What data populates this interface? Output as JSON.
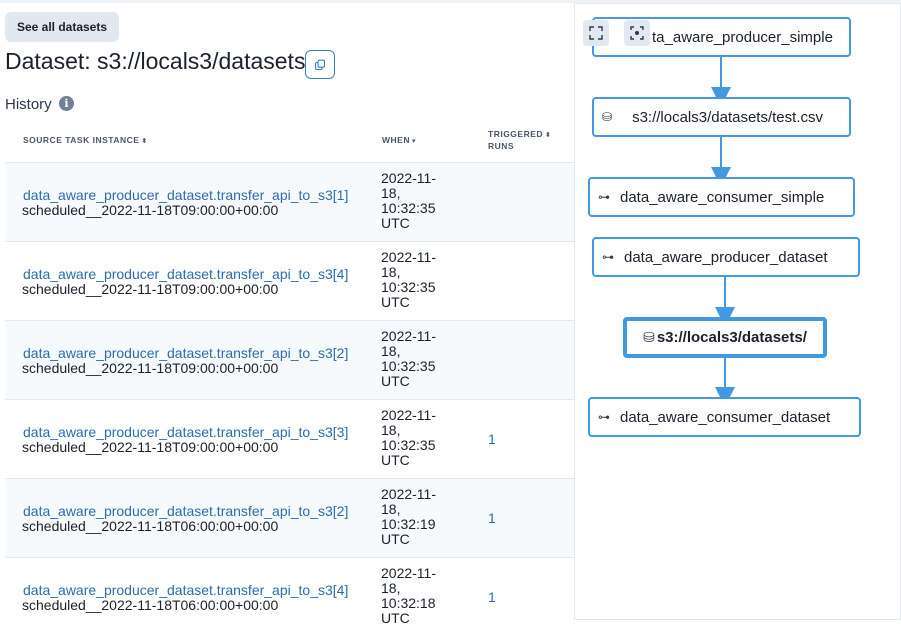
{
  "nav": {
    "see_all_label": "See all datasets"
  },
  "page": {
    "title": "Dataset: s3://locals3/datasets/"
  },
  "history": {
    "label": "History",
    "info_icon_glyph": "i",
    "columns": {
      "source": "SOURCE TASK INSTANCE",
      "when": "WHEN",
      "triggered_line1": "TRIGGERED",
      "triggered_line2": "RUNS"
    },
    "sort_glyphs": {
      "both": "⬍",
      "down": "▾"
    },
    "rows": [
      {
        "task": "data_aware_producer_dataset.transfer_api_to_s3[1]",
        "run_id": "scheduled__2022-11-18T09:00:00+00:00",
        "when": [
          "2022-11-",
          "18,",
          "10:32:35",
          "UTC"
        ],
        "runs": ""
      },
      {
        "task": "data_aware_producer_dataset.transfer_api_to_s3[4]",
        "run_id": "scheduled__2022-11-18T09:00:00+00:00",
        "when": [
          "2022-11-",
          "18,",
          "10:32:35",
          "UTC"
        ],
        "runs": ""
      },
      {
        "task": "data_aware_producer_dataset.transfer_api_to_s3[2]",
        "run_id": "scheduled__2022-11-18T09:00:00+00:00",
        "when": [
          "2022-11-",
          "18,",
          "10:32:35",
          "UTC"
        ],
        "runs": ""
      },
      {
        "task": "data_aware_producer_dataset.transfer_api_to_s3[3]",
        "run_id": "scheduled__2022-11-18T09:00:00+00:00",
        "when": [
          "2022-11-",
          "18,",
          "10:32:35",
          "UTC"
        ],
        "runs": "1"
      },
      {
        "task": "data_aware_producer_dataset.transfer_api_to_s3[2]",
        "run_id": "scheduled__2022-11-18T06:00:00+00:00",
        "when": [
          "2022-11-",
          "18,",
          "10:32:19",
          "UTC"
        ],
        "runs": "1"
      },
      {
        "task": "data_aware_producer_dataset.transfer_api_to_s3[4]",
        "run_id": "scheduled__2022-11-18T06:00:00+00:00",
        "when": [
          "2022-11-",
          "18,",
          "10:32:18",
          "UTC"
        ],
        "runs": "1"
      }
    ]
  },
  "graph": {
    "nodes": [
      {
        "label": "ta_aware_producer_simple",
        "icon": "dag",
        "glyph": ""
      },
      {
        "label": "s3://locals3/datasets/test.csv",
        "icon": "dataset",
        "glyph": "⛁"
      },
      {
        "label": "data_aware_consumer_simple",
        "icon": "dag",
        "glyph": "⊶"
      },
      {
        "label": "data_aware_producer_dataset",
        "icon": "dag",
        "glyph": "⊶"
      },
      {
        "label": "s3://locals3/datasets/",
        "icon": "dataset",
        "glyph": "⛁"
      },
      {
        "label": "data_aware_consumer_dataset",
        "icon": "dag",
        "glyph": "⊶"
      }
    ],
    "controls": [
      "expand-icon",
      "focus-icon"
    ]
  },
  "colors": {
    "accent": "#4299e1",
    "link": "#2b6cb0",
    "button_bg": "#e2e8f0"
  }
}
